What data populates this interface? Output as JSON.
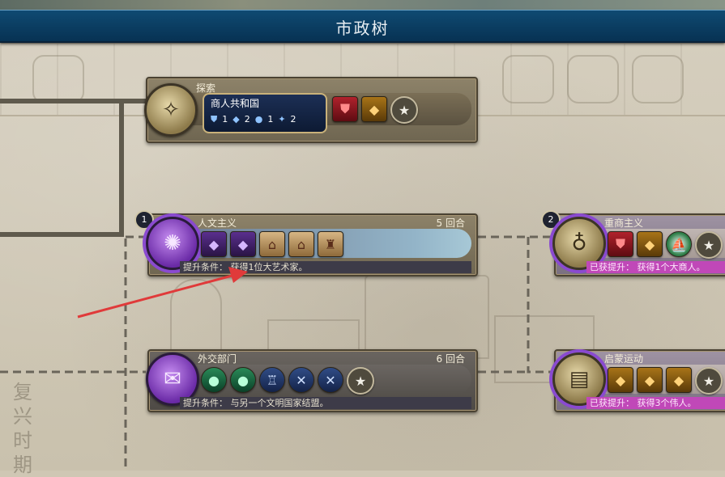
{
  "header": {
    "title": "市政树"
  },
  "era": {
    "label": "复兴时期"
  },
  "cards": {
    "explore": {
      "name": "探索",
      "government": {
        "name": "商人共和国",
        "slots": [
          "1",
          "2",
          "1",
          "2"
        ]
      }
    },
    "humanism": {
      "badge": "1",
      "name": "人文主义",
      "turns": "5 回合",
      "boost": "提升条件：  获得1位大艺术家。"
    },
    "diplomatic": {
      "name": "外交部门",
      "turns": "6 回合",
      "boost": "提升条件：  与另一个文明国家结盟。"
    },
    "mercantilism": {
      "badge": "2",
      "name": "重商主义",
      "boost": "已获提升：  获得1个大商人。"
    },
    "enlightenment": {
      "name": "启蒙运动",
      "boost": "已获提升：  获得3个伟人。"
    }
  },
  "icons": {
    "compass": "compass-icon",
    "vitruvian": "vitruvian-man-icon",
    "letter": "diplomatic-letter-icon",
    "moneybag": "money-bag-icon",
    "book": "book-icon"
  },
  "colors": {
    "header_bg": "#0f4a72",
    "boosted_bar": "#c048b8",
    "progress_ring": "#8a4ad0",
    "annotation_arrow": "#e03a3a"
  }
}
